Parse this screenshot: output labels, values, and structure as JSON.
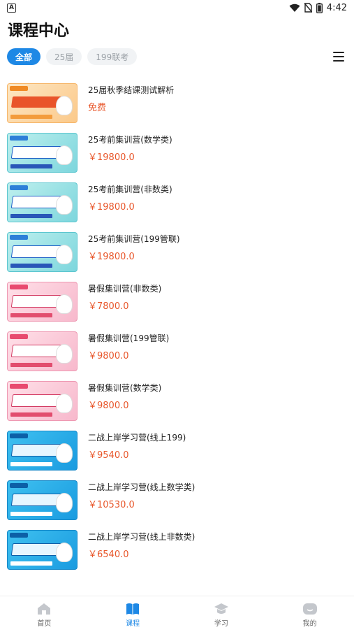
{
  "status_bar": {
    "time": "4:42",
    "left_icon": "A",
    "icons": [
      "wifi-icon",
      "no-sim-icon",
      "battery-icon"
    ]
  },
  "page_title": "课程中心",
  "tabs": [
    {
      "label": "全部",
      "active": true
    },
    {
      "label": "25届",
      "active": false
    },
    {
      "label": "199联考",
      "active": false
    }
  ],
  "courses": [
    {
      "title": "25届秋季结课测试解析",
      "price": "免费",
      "thumb_style": "orange"
    },
    {
      "title": "25考前集训营(数学类)",
      "price": "￥19800.0",
      "thumb_style": "teal"
    },
    {
      "title": "25考前集训营(非数类)",
      "price": "￥19800.0",
      "thumb_style": "teal"
    },
    {
      "title": "25考前集训营(199管联)",
      "price": "￥19800.0",
      "thumb_style": "teal"
    },
    {
      "title": "暑假集训营(非数类)",
      "price": "￥7800.0",
      "thumb_style": "pink"
    },
    {
      "title": "暑假集训营(199管联)",
      "price": "￥9800.0",
      "thumb_style": "pink"
    },
    {
      "title": "暑假集训营(数学类)",
      "price": "￥9800.0",
      "thumb_style": "pink"
    },
    {
      "title": "二战上岸学习营(线上199)",
      "price": "￥9540.0",
      "thumb_style": "blue"
    },
    {
      "title": "二战上岸学习营(线上数学类)",
      "price": "￥10530.0",
      "thumb_style": "blue"
    },
    {
      "title": "二战上岸学习营(线上非数类)",
      "price": "￥6540.0",
      "thumb_style": "blue"
    }
  ],
  "bottom_nav": [
    {
      "label": "首页",
      "icon": "home-icon",
      "active": false
    },
    {
      "label": "课程",
      "icon": "book-icon",
      "active": true
    },
    {
      "label": "学习",
      "icon": "graduation-cap-icon",
      "active": false
    },
    {
      "label": "我的",
      "icon": "profile-icon",
      "active": false
    }
  ],
  "colors": {
    "accent": "#1e88e5",
    "price": "#e8562a",
    "tab_inactive_bg": "#f1f3f5",
    "nav_inactive_icon": "#c4c7cc"
  }
}
